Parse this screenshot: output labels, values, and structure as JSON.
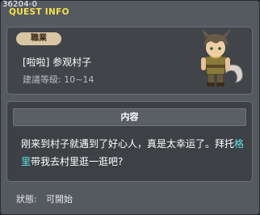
{
  "window": {
    "id": "36204-0",
    "title": "QUEST INFO"
  },
  "quest": {
    "job_badge": "職業",
    "name": "[啦啦] 参观村子",
    "level_label": "建議等級:",
    "level_range": "10~14"
  },
  "content": {
    "header": "内容",
    "text_part1": "刚来到村子就遇到了好心人，真是太幸运了。拜托",
    "npc_name": "格里",
    "text_part2": "带我去村里逛一逛吧?"
  },
  "status": {
    "label": "狀態:",
    "value": "可開始"
  },
  "colors": {
    "title": "#f4e04d",
    "npc_highlight": "#5fe0e6",
    "badge_bg": "#d9c6a4"
  }
}
